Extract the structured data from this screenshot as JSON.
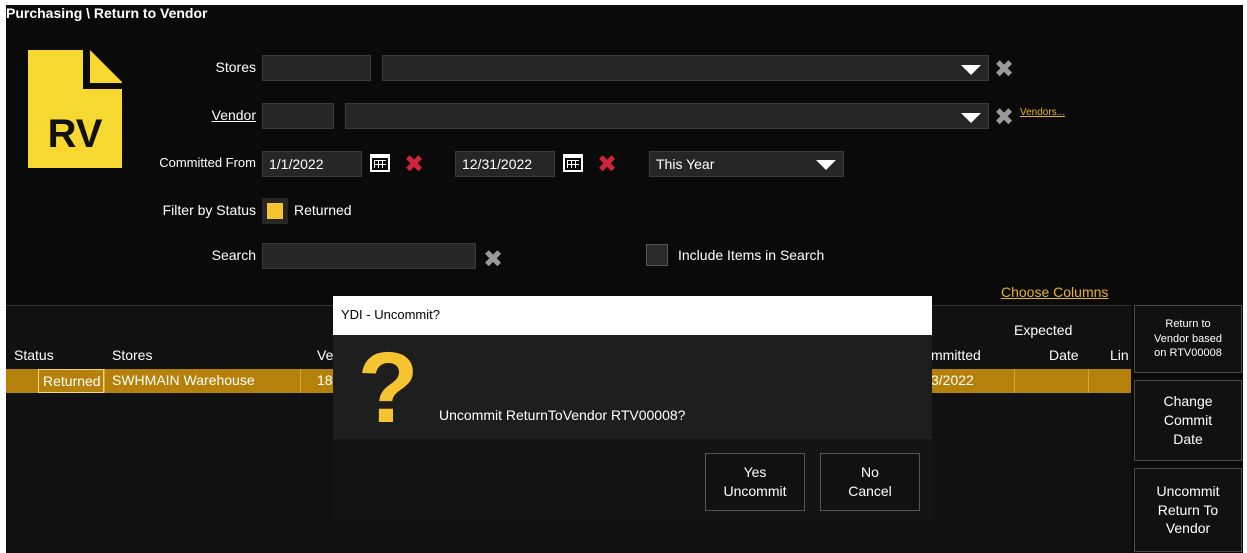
{
  "breadcrumb": "Purchasing \\ Return to Vendor",
  "logo": {
    "text": "RV",
    "color": "#f6d830"
  },
  "filters": {
    "stores_label": "Stores",
    "vendor_label": "Vendor",
    "vendors_link": "Vendors...",
    "committed_from_label": "Committed From",
    "date_from": "1/1/2022",
    "date_to": "12/31/2022",
    "period": "This Year",
    "filter_status_label": "Filter by Status",
    "status_returned": "Returned",
    "search_label": "Search",
    "include_items_label": "Include Items in Search"
  },
  "choose_columns": "Choose Columns",
  "table": {
    "headers": {
      "status": "Status",
      "stores": "Stores",
      "vendor_partial": "Ve",
      "committed_partial": "mmitted",
      "expected_line1": "Expected",
      "expected_line2": "Date",
      "line_partial": "Lin"
    },
    "rows": [
      {
        "status": "Returned",
        "stores": "SWHMAIN Warehouse",
        "vendor_partial": "18",
        "committed_partial": "3/2022"
      }
    ]
  },
  "side_buttons": {
    "based_on_l1": "Return to",
    "based_on_l2": "Vendor based",
    "based_on_l3": "on RTV00008",
    "change_l1": "Change",
    "change_l2": "Commit",
    "change_l3": "Date",
    "uncommit_l1": "Uncommit",
    "uncommit_l2": "Return To",
    "uncommit_l3": "Vendor"
  },
  "dialog": {
    "title": "YDI - Uncommit?",
    "message": "Uncommit ReturnToVendor RTV00008?",
    "yes_l1": "Yes",
    "yes_l2": "Uncommit",
    "no_l1": "No",
    "no_l2": "Cancel"
  },
  "colors": {
    "accent": "#e7b431",
    "row_highlight": "#b6810a",
    "delete_red": "#d0243a",
    "question_yellow": "#f6c430"
  }
}
